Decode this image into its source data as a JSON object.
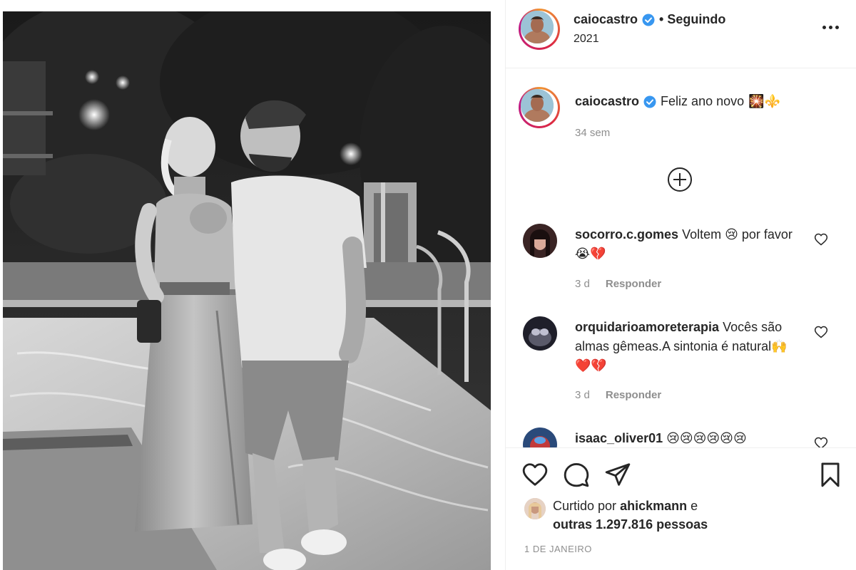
{
  "post": {
    "username": "caiocastro",
    "follow_status": "• Seguindo",
    "subtitle": "2021"
  },
  "caption": {
    "username": "caiocastro",
    "text": "Feliz ano novo",
    "emojis": "🎇⚜️",
    "time": "34 sem"
  },
  "comments": [
    {
      "username": "socorro.c.gomes",
      "text": "Voltem 😢 por favor 😭💔",
      "time": "3 d",
      "reply": "Responder"
    },
    {
      "username": "orquidarioamoreterapia",
      "text": "Vocês são almas gêmeas.A sintonia é natural🙌❤️💔",
      "time": "3 d",
      "reply": "Responder"
    },
    {
      "username": "isaac_oliver01",
      "text": "😢😢😢😢😢😢",
      "time": "",
      "reply": ""
    }
  ],
  "likes": {
    "prefix": "Curtido por",
    "user": "ahickmann",
    "connector": "e",
    "others": "outras 1.297.816 pessoas"
  },
  "date": "1 DE JANEIRO",
  "icons": [
    "verified-badge-icon",
    "more-options-icon",
    "load-more-comments-icon",
    "heart-icon",
    "comment-icon",
    "share-icon",
    "save-bookmark-icon"
  ],
  "colors": {
    "verified": "#3897f0",
    "muted": "#8e8e8e",
    "text": "#262626",
    "divider": "#efefef"
  }
}
